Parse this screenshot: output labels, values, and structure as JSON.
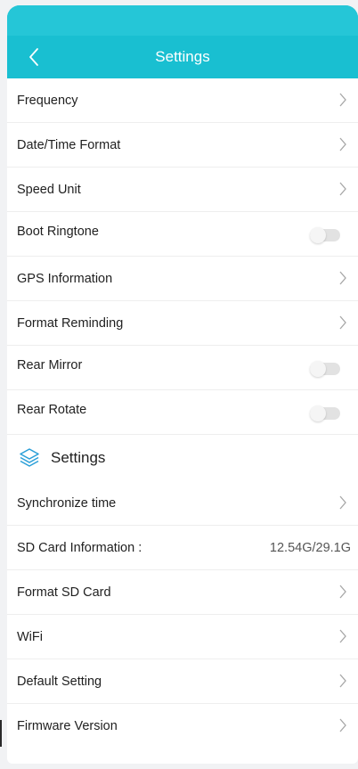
{
  "header": {
    "title": "Settings"
  },
  "rows_top": [
    {
      "label": "Frequency",
      "control": "chevron"
    },
    {
      "label": "Date/Time Format",
      "control": "chevron"
    },
    {
      "label": "Speed Unit",
      "control": "chevron"
    },
    {
      "label": "Boot Ringtone",
      "control": "toggle",
      "on": false
    },
    {
      "label": "GPS Information",
      "control": "chevron"
    },
    {
      "label": "Format Reminding",
      "control": "chevron"
    },
    {
      "label": "Rear Mirror",
      "control": "toggle",
      "on": false
    },
    {
      "label": "Rear Rotate",
      "control": "toggle",
      "on": false
    }
  ],
  "section": {
    "title": "Settings",
    "icon": "layers-icon"
  },
  "rows_bottom": [
    {
      "label": "Synchronize time",
      "control": "chevron"
    },
    {
      "label": "SD Card Information :",
      "value": "12.54G/29.1G"
    },
    {
      "label": "Format SD Card",
      "control": "chevron"
    },
    {
      "label": "WiFi",
      "control": "chevron"
    },
    {
      "label": "Default Setting",
      "control": "chevron"
    },
    {
      "label": "Firmware Version",
      "control": "chevron"
    }
  ],
  "colors": {
    "header_bg": "#19bfd1",
    "accent": "#2a9fd8",
    "toggle_off": "#e2e2e2"
  }
}
